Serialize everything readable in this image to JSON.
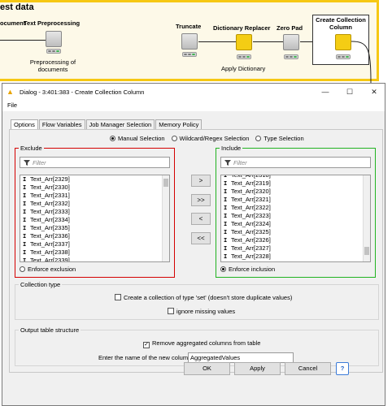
{
  "workflow": {
    "title": "est data",
    "nodes": {
      "document": "ocument",
      "text_preprocessing": "Text Preprocessing",
      "preprocessing_sub": "Preprocessing of documents",
      "truncate": "Truncate",
      "dictionary_replacer": "Dictionary Replacer",
      "apply_dictionary": "Apply Dictionary",
      "zero_pad": "Zero Pad",
      "create_collection": "Create Collection Column"
    },
    "accent_color": "#f6c813"
  },
  "dialog": {
    "title": "Dialog - 3:401:383 - Create Collection Column",
    "menu": "File",
    "tabs": [
      "Options",
      "Flow Variables",
      "Job Manager Selection",
      "Memory Policy"
    ],
    "modes": [
      "Manual Selection",
      "Wildcard/Regex Selection",
      "Type Selection"
    ],
    "exclude": {
      "title": "Exclude",
      "filter_placeholder": "Filter",
      "items": [
        "Text_Arr[2329]",
        "Text_Arr[2330]",
        "Text_Arr[2331]",
        "Text_Arr[2332]",
        "Text_Arr[2333]",
        "Text_Arr[2334]",
        "Text_Arr[2335]",
        "Text_Arr[2336]",
        "Text_Arr[2337]",
        "Text_Arr[2338]",
        "Text_Arr[2339]"
      ],
      "enforce_label": "Enforce exclusion",
      "border_color": "#d40000"
    },
    "include": {
      "title": "Include",
      "filter_placeholder": "Filter",
      "items": [
        "Text_Arr[2318]",
        "Text_Arr[2319]",
        "Text_Arr[2320]",
        "Text_Arr[2321]",
        "Text_Arr[2322]",
        "Text_Arr[2323]",
        "Text_Arr[2324]",
        "Text_Arr[2325]",
        "Text_Arr[2326]",
        "Text_Arr[2327]",
        "Text_Arr[2328]"
      ],
      "enforce_label": "Enforce inclusion",
      "border_color": "#21b321"
    },
    "move_buttons": [
      ">",
      ">>",
      "<",
      "<<"
    ],
    "collection_type": {
      "title": "Collection type",
      "set_label": "Create a collection of type 'set' (doesn't store duplicate values)",
      "ignore_missing_label": "ignore missing values"
    },
    "output": {
      "title": "Output table structure",
      "remove_label": "Remove aggregated columns from table",
      "new_column_label": "Enter the name of the new column:",
      "new_column_value": "AggregatedValues"
    },
    "buttons": {
      "ok": "OK",
      "apply": "Apply",
      "cancel": "Cancel",
      "help": "?"
    }
  }
}
